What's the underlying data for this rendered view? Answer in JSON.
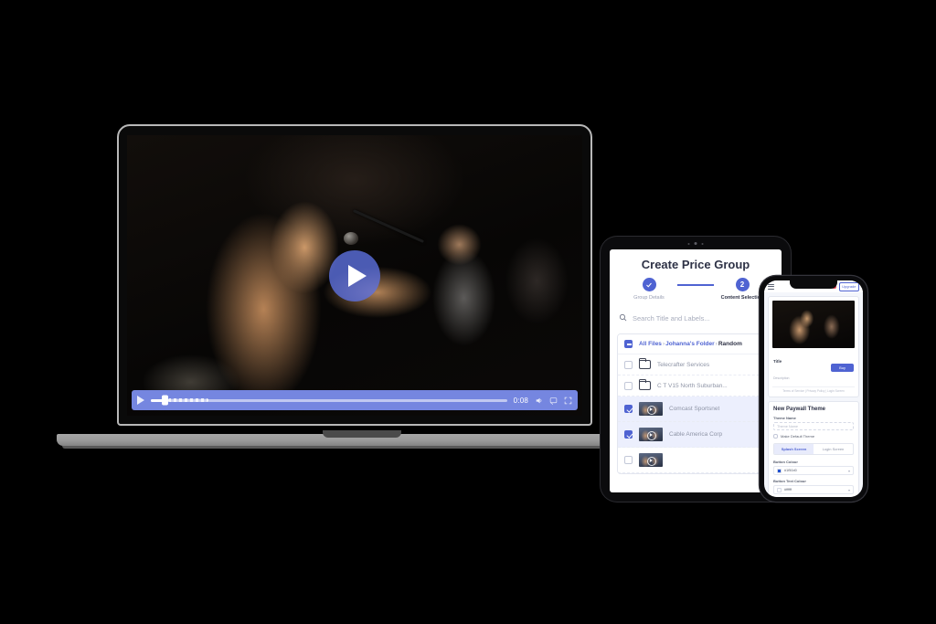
{
  "background": "#000000",
  "accent": "#4F63D2",
  "laptop": {
    "device_name": "laptop",
    "player": {
      "play_button_label": "play-video",
      "time": "0:08",
      "progress_percent": 3.5,
      "controls": [
        "play-icon",
        "progress-slider",
        "time",
        "volume-icon",
        "cast-icon",
        "fullscreen-icon"
      ]
    },
    "video": {
      "alt": "Female singer performing on stage with microphone, guitarist behind"
    }
  },
  "tablet": {
    "device_name": "tablet",
    "title": "Create Price Group",
    "stepper": [
      {
        "label": "Group Details",
        "marker": "check",
        "state": "done"
      },
      {
        "label": "Content Selection",
        "marker": "2",
        "state": "active"
      }
    ],
    "search": {
      "placeholder": "Search Title and Labels...",
      "icon": "search-icon"
    },
    "breadcrumb": {
      "checkbox_state": "indeterminate",
      "parts": [
        "All Files",
        "Johanna's Folder",
        "Random"
      ],
      "separator": "›"
    },
    "rows": [
      {
        "name": "Telecrafter Services",
        "type": "folder",
        "checked": false
      },
      {
        "name": "C T V15 North Suburban...",
        "type": "folder",
        "checked": false
      },
      {
        "name": "Comcast Sportsnet",
        "type": "video",
        "checked": true
      },
      {
        "name": "Cable America Corp",
        "type": "video",
        "checked": true
      }
    ]
  },
  "phone": {
    "device_name": "phone",
    "topbar": {
      "menu_icon": "hamburger-icon",
      "upgrade_label": "Upgrade"
    },
    "preview": {
      "title": "Title",
      "description": "Description",
      "buy_label": "Buy",
      "footer": "Terms of Service | Privacy Policy | Login Screen"
    },
    "form": {
      "heading": "New Paywall Theme",
      "theme_name_label": "Theme Name",
      "theme_name_placeholder": "Theme Name",
      "default_theme_label": "Make Default Theme",
      "default_theme_checked": false,
      "tabs": [
        {
          "label": "Splash Screen",
          "active": true
        },
        {
          "label": "Login Screen",
          "active": false
        }
      ],
      "button_colour_label": "Button Colour",
      "button_colour_value": "#1f50d0",
      "button_text_colour_label": "Button Text Colour",
      "button_text_colour_value": "#ffffff"
    }
  }
}
